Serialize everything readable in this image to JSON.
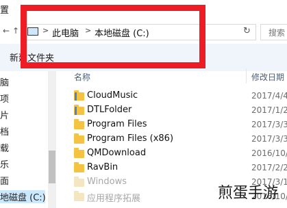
{
  "window": {
    "title_fragment": "置"
  },
  "address_bar": {
    "back": "←",
    "up": "↑",
    "crumbs": [
      "此电脑",
      "本地磁盘 (C:)"
    ],
    "separator": ">",
    "refresh": "↻",
    "search_placeholder": "搜索"
  },
  "toolbar": {
    "new_folder_label": "新建文件夹",
    "collapse": "^"
  },
  "nav_pane": {
    "items": [
      "脑",
      "项",
      "片",
      "档",
      "载",
      "乐",
      "面",
      "地磁盘 (C:)"
    ],
    "selected_index": 7
  },
  "columns": {
    "name": "名称",
    "date": "修改日期"
  },
  "files": [
    {
      "name": "CloudMusic",
      "date": "2017/4/4",
      "icon": "app-folder-icon"
    },
    {
      "name": "DTLFolder",
      "date": "2017/1/2",
      "icon": "app-folder-icon"
    },
    {
      "name": "Program Files",
      "date": "2017/3/3",
      "icon": "folder-icon"
    },
    {
      "name": "Program Files (x86)",
      "date": "2017/3/3",
      "icon": "folder-icon"
    },
    {
      "name": "QMDownload",
      "date": "2016/10/",
      "icon": "folder-icon"
    },
    {
      "name": "RavBin",
      "date": "2017/2/2",
      "icon": "folder-icon"
    },
    {
      "name": "Windows",
      "date": "2017/3/1",
      "icon": "folder-icon"
    },
    {
      "name": "应用程序拓展",
      "date": "2016/10/",
      "icon": "folder-icon"
    }
  ],
  "highlight": {
    "color": "#ee1c25"
  },
  "watermark": "煎蛋手游"
}
